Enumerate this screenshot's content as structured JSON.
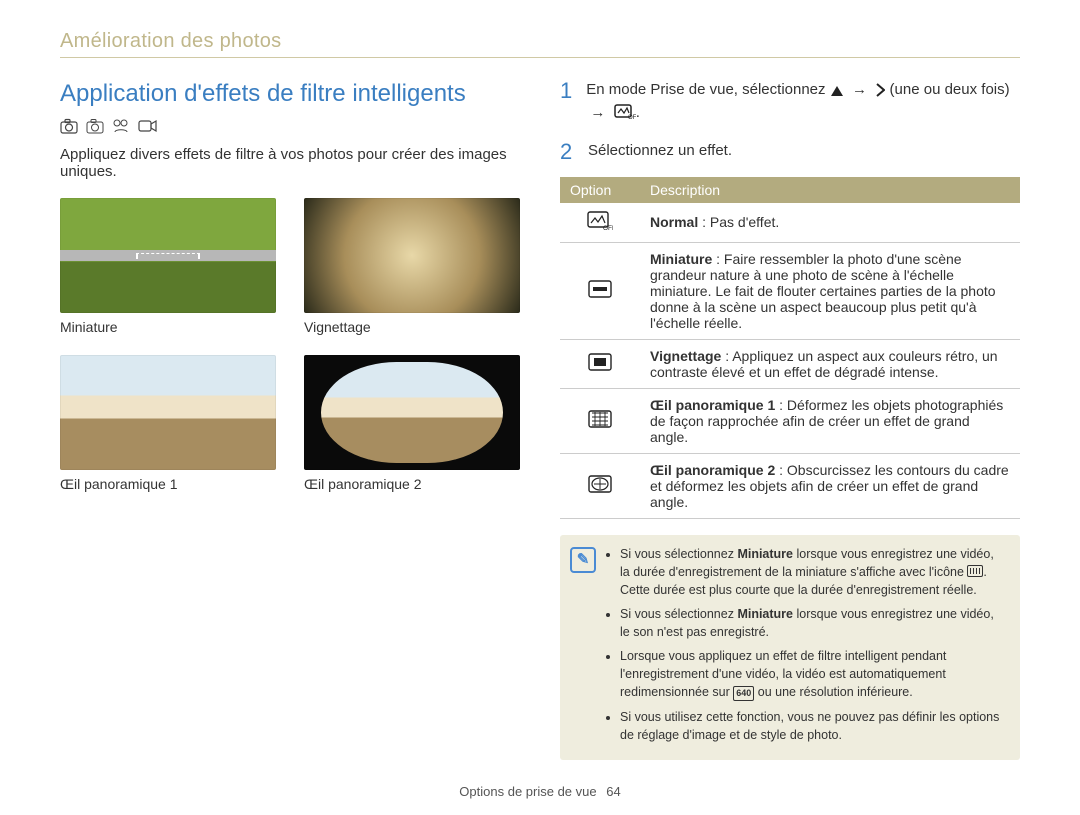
{
  "header": "Amélioration des photos",
  "section_title": "Application d'effets de filtre intelligents",
  "intro": "Appliquez divers effets de filtre à vos photos pour créer des images uniques.",
  "thumbs": {
    "miniature": "Miniature",
    "vignette": "Vignettage",
    "fisheye1": "Œil panoramique 1",
    "fisheye2": "Œil panoramique 2"
  },
  "steps": {
    "s1": {
      "n": "1",
      "pre": "En mode Prise de vue, sélectionnez",
      "mid": "(une ou deux fois)"
    },
    "s2": {
      "n": "2",
      "text": "Sélectionnez un effet."
    }
  },
  "table": {
    "h_option": "Option",
    "h_desc": "Description",
    "rows": {
      "normal": {
        "label": "Normal",
        "text": " : Pas d'effet."
      },
      "miniature": {
        "label": "Miniature",
        "text": " : Faire ressembler la photo d'une scène grandeur nature à une photo de scène à l'échelle miniature. Le fait de flouter certaines parties de la photo donne à la scène un aspect beaucoup plus petit qu'à l'échelle réelle."
      },
      "vignette": {
        "label": "Vignettage",
        "text": " : Appliquez un aspect aux couleurs rétro, un contraste élevé et un effet de dégradé intense."
      },
      "fe1": {
        "label": "Œil panoramique 1",
        "text": " : Déformez les objets photographiés de façon rapprochée afin de créer un effet de grand angle."
      },
      "fe2": {
        "label": "Œil panoramique 2",
        "text": " : Obscurcissez les contours du cadre et déformez les objets afin de créer un effet de grand angle."
      }
    }
  },
  "note": {
    "b1a": "Si vous sélectionnez ",
    "b1bold": "Miniature",
    "b1b": " lorsque vous enregistrez une vidéo, la durée d'enregistrement de la miniature s'affiche avec l'icône ",
    "b1c": ". Cette durée est plus courte que la durée d'enregistrement réelle.",
    "b2a": "Si vous sélectionnez ",
    "b2bold": "Miniature",
    "b2b": " lorsque vous enregistrez une vidéo, le son n'est pas enregistré.",
    "b3a": "Lorsque vous appliquez un effet de filtre intelligent pendant l'enregistrement d'une vidéo, la vidéo est automatiquement redimensionnée sur ",
    "b3res": "640",
    "b3b": " ou une résolution inférieure.",
    "b4": "Si vous utilisez cette fonction, vous ne pouvez pas définir les options de réglage d'image et de style de photo."
  },
  "footer": {
    "section": "Options de prise de vue",
    "page": "64"
  }
}
